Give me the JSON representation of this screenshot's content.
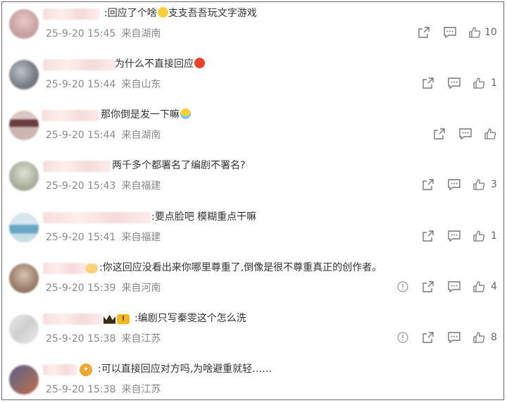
{
  "comments": [
    {
      "text": ":回应了个啥",
      "emoji": "sweat-emoji",
      "text_after": "支支吾吾玩文字游戏",
      "date": "25-9-20 15:45",
      "location": "来自湖南",
      "likes": "10",
      "report": false
    },
    {
      "text": "为什么不直接回应",
      "emoji": "angry-emoji",
      "text_after": "",
      "date": "25-9-20 15:44",
      "location": "来自山东",
      "likes": "1",
      "report": false
    },
    {
      "text": "那你倒是发一下嘛",
      "emoji": "cry-emoji",
      "text_after": "",
      "date": "25-9-20 15:44",
      "location": "来自湖南",
      "likes": "",
      "report": false
    },
    {
      "text": "两千多个都署名了编剧不署名?",
      "emoji": "",
      "text_after": "",
      "date": "25-9-20 15:43",
      "location": "来自福建",
      "likes": "3",
      "report": false
    },
    {
      "text": ":要点脸吧 模糊重点干嘛",
      "emoji": "",
      "text_after": "",
      "date": "25-9-20 15:41",
      "location": "来自福建",
      "likes": "1",
      "report": false
    },
    {
      "text": ":你这回应没看出来你哪里尊重了,倒像是很不尊重真正的创作者。",
      "emoji": "",
      "text_after": "",
      "date": "25-9-20 15:39",
      "location": "来自河南",
      "likes": "4",
      "report": true
    },
    {
      "text": ":编剧只写秦雯这个怎么洗",
      "emoji": "",
      "text_after": "",
      "date": "25-9-20 15:38",
      "location": "来自江苏",
      "likes": "8",
      "report": true
    },
    {
      "text": ":可以直接回应对方吗,为啥避重就轻……",
      "emoji": "",
      "text_after": "",
      "date": "25-9-20 15:38",
      "location": "来自江苏",
      "likes": "",
      "report": false
    }
  ],
  "badge_level": "I",
  "icons": {
    "share": "share-icon",
    "comment": "comment-icon",
    "like": "thumbs-up-icon",
    "report": "report-icon"
  },
  "colors": {
    "text": "#333333",
    "meta": "#8a8a8a",
    "icon": "#777777",
    "border": "#6b6b6b"
  }
}
